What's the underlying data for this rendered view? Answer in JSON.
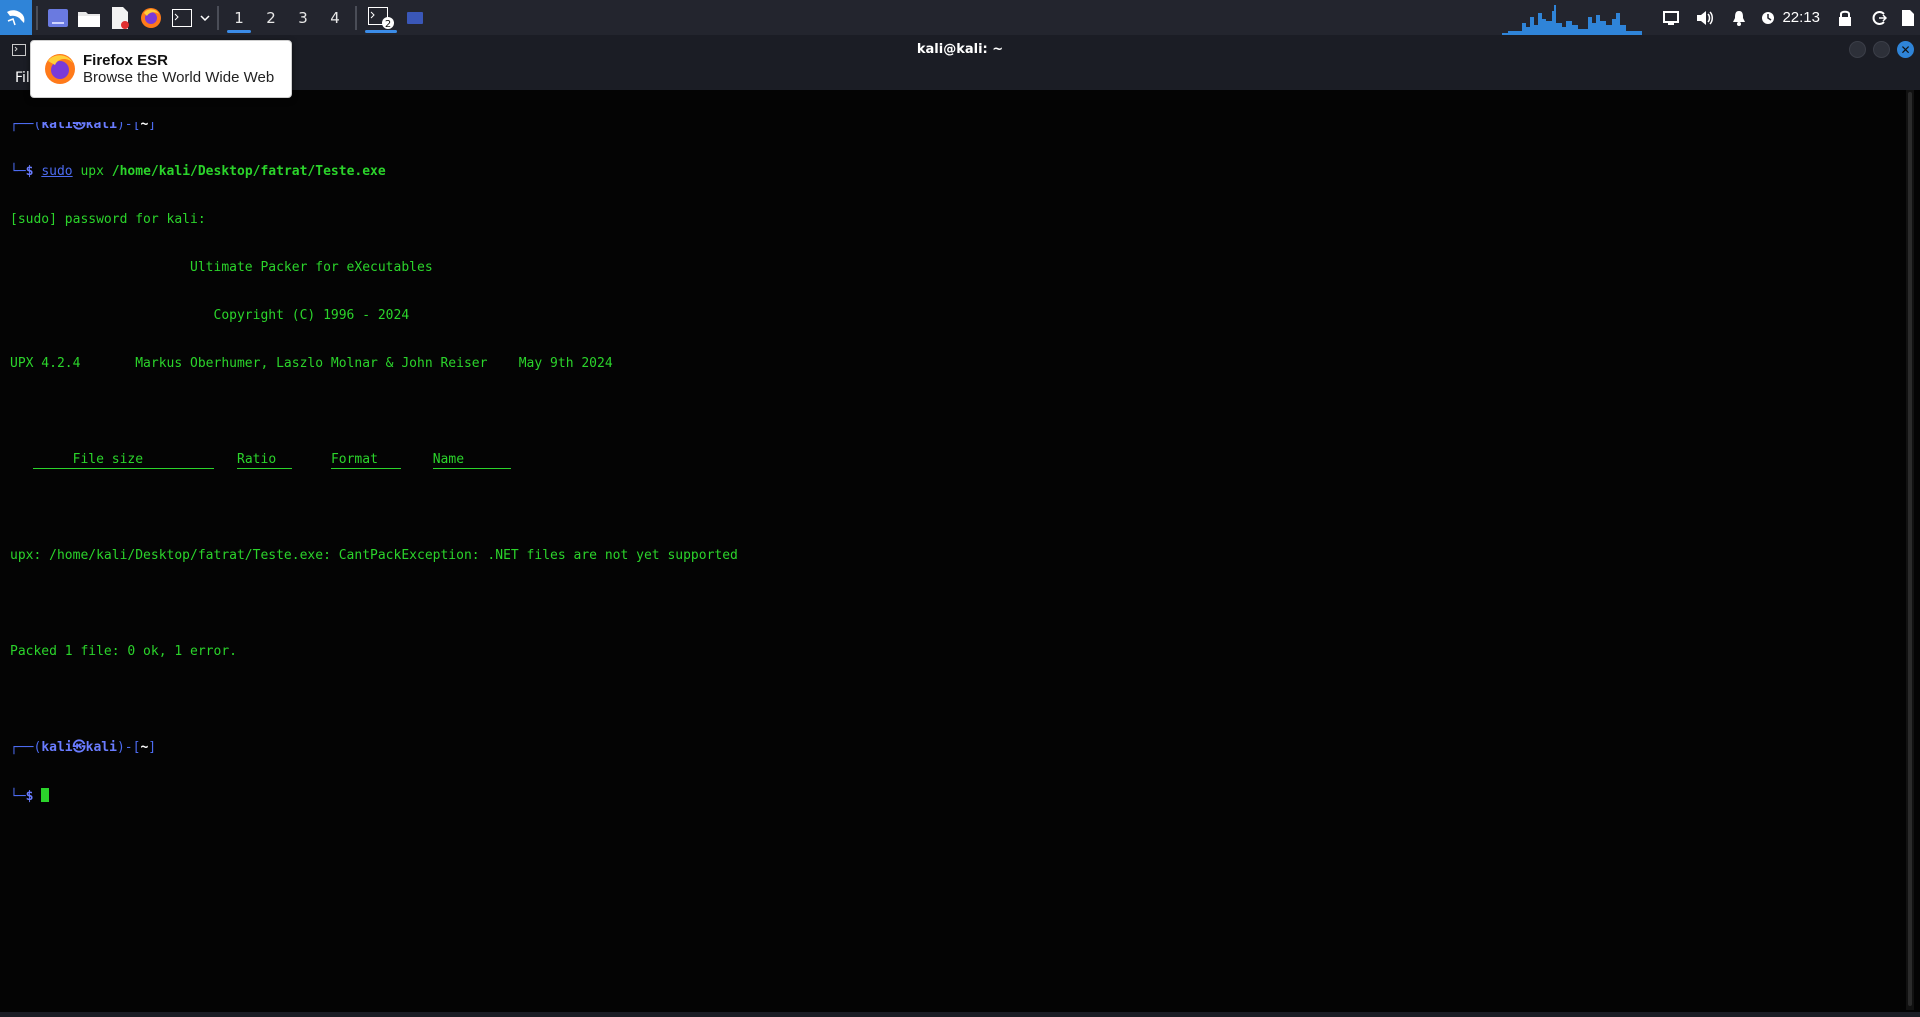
{
  "panel": {
    "workspaces": [
      "1",
      "2",
      "3",
      "4"
    ],
    "active_workspace": "1",
    "task_badge": "2",
    "clock": "22:13"
  },
  "tooltip": {
    "title": "Firefox ESR",
    "subtitle": "Browse the World Wide Web"
  },
  "window": {
    "title": "kali@kali: ~",
    "menu_first": "File"
  },
  "terminal": {
    "prompt1_user": "kali",
    "prompt1_host": "kali",
    "prompt1_dir": "~",
    "cmd_sudo": "sudo",
    "cmd_rest_plain": " upx ",
    "cmd_arg": "/home/kali/Desktop/fatrat/Teste.exe",
    "line_password": "[sudo] password for kali:",
    "line_title": "                       Ultimate Packer for eXecutables",
    "line_copyright": "                          Copyright (C) 1996 - 2024",
    "line_version": "UPX 4.2.4       Markus Oberhumer, Laszlo Molnar & John Reiser    May 9th 2024",
    "col_filesize": "File size",
    "col_ratio": "Ratio",
    "col_format": "Format",
    "col_name": "Name",
    "line_error": "upx: /home/kali/Desktop/fatrat/Teste.exe: CantPackException: .NET files are not yet supported",
    "line_summary": "Packed 1 file: 0 ok, 1 error.",
    "prompt2_user": "kali",
    "prompt2_host": "kali",
    "prompt2_dir": "~"
  },
  "colors": {
    "panel_bg": "#23252e",
    "accent": "#2f84d8",
    "terminal_green": "#2bd42b",
    "prompt_blue": "#4c6bf0"
  }
}
